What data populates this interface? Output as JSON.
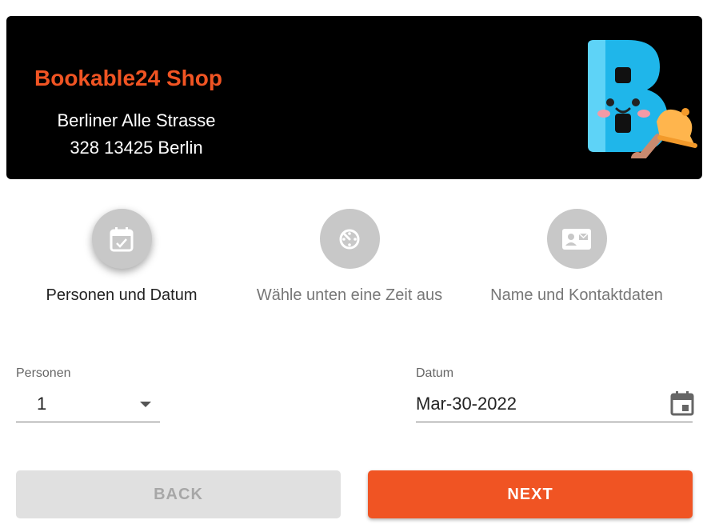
{
  "header": {
    "shop_name": "Bookable24 Shop",
    "address_line1": "Berliner Alle Strasse",
    "address_line2": "328 13425 Berlin",
    "logo_icon": "bookable-b-bell-logo"
  },
  "steps": [
    {
      "label": "Personen und Datum",
      "icon": "calendar-check-icon",
      "active": true
    },
    {
      "label": "Wähle unten eine Zeit aus",
      "icon": "timer-icon",
      "active": false
    },
    {
      "label": "Name und Kontaktdaten",
      "icon": "contact-card-icon",
      "active": false
    }
  ],
  "form": {
    "persons_label": "Personen",
    "persons_value": "1",
    "date_label": "Datum",
    "date_value": "Mar-30-2022"
  },
  "buttons": {
    "back_label": "BACK",
    "next_label": "NEXT"
  },
  "colors": {
    "accent": "#f05423",
    "header_bg": "#000000",
    "step_circle": "#c8c8c8",
    "disabled_bg": "#e0e0e0"
  }
}
